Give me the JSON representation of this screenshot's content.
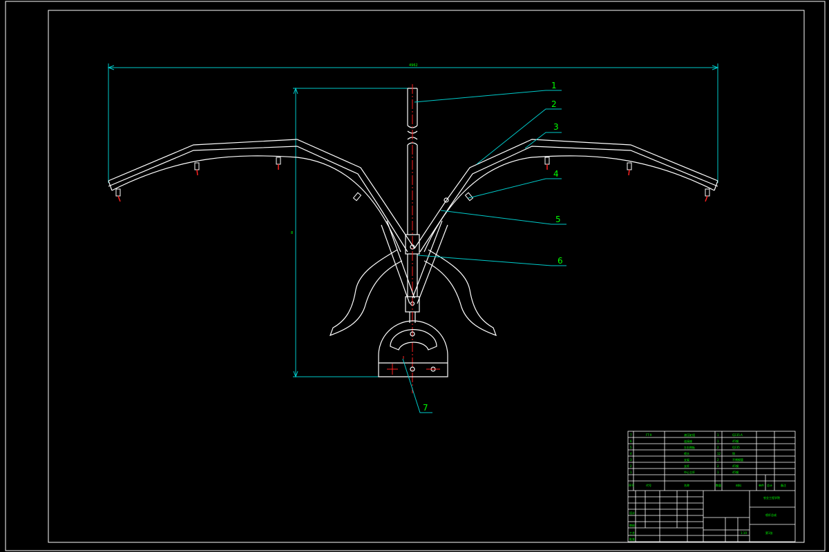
{
  "drawing": {
    "background": "#000000",
    "line_color": "#ffffff",
    "dimension_color": "#00cccc",
    "leader_color": "#00cccc",
    "label_color": "#00ff00",
    "centerline_color": "#ff2020",
    "part_labels": [
      "1",
      "2",
      "3",
      "4",
      "5",
      "6",
      "7"
    ],
    "dimension_width_text": "4962",
    "dimension_height_text": "8"
  },
  "title_block": {
    "bom_rows": [
      {
        "no": "7",
        "code": "FT-9",
        "name": "液压缸组",
        "qty": "1",
        "material": "Q235-A"
      },
      {
        "no": "6",
        "code": "",
        "name": "连接座",
        "qty": "1",
        "material": "45钢"
      },
      {
        "no": "5",
        "code": "",
        "name": "左右侧板",
        "qty": "2",
        "material": "Q235"
      },
      {
        "no": "4",
        "code": "",
        "name": "喷头",
        "qty": "12",
        "material": "铜"
      },
      {
        "no": "3",
        "code": "",
        "name": "支架",
        "qty": "2",
        "material": "不锈钢管"
      },
      {
        "no": "2",
        "code": "",
        "name": "支杆",
        "qty": "2",
        "material": "45钢"
      },
      {
        "no": "1",
        "code": "",
        "name": "中心立杆",
        "qty": "1",
        "material": "45钢"
      }
    ],
    "bom_header": [
      "序号",
      "代号",
      "名称",
      "数量",
      "材料",
      "单件",
      "总计",
      "备注"
    ],
    "drawing_title": "喷杆总成",
    "school": "农业工程学院",
    "scale": "1:10",
    "sheet": "第1张",
    "sign_rows": [
      "设计",
      "审核",
      "工艺",
      "批准"
    ]
  }
}
